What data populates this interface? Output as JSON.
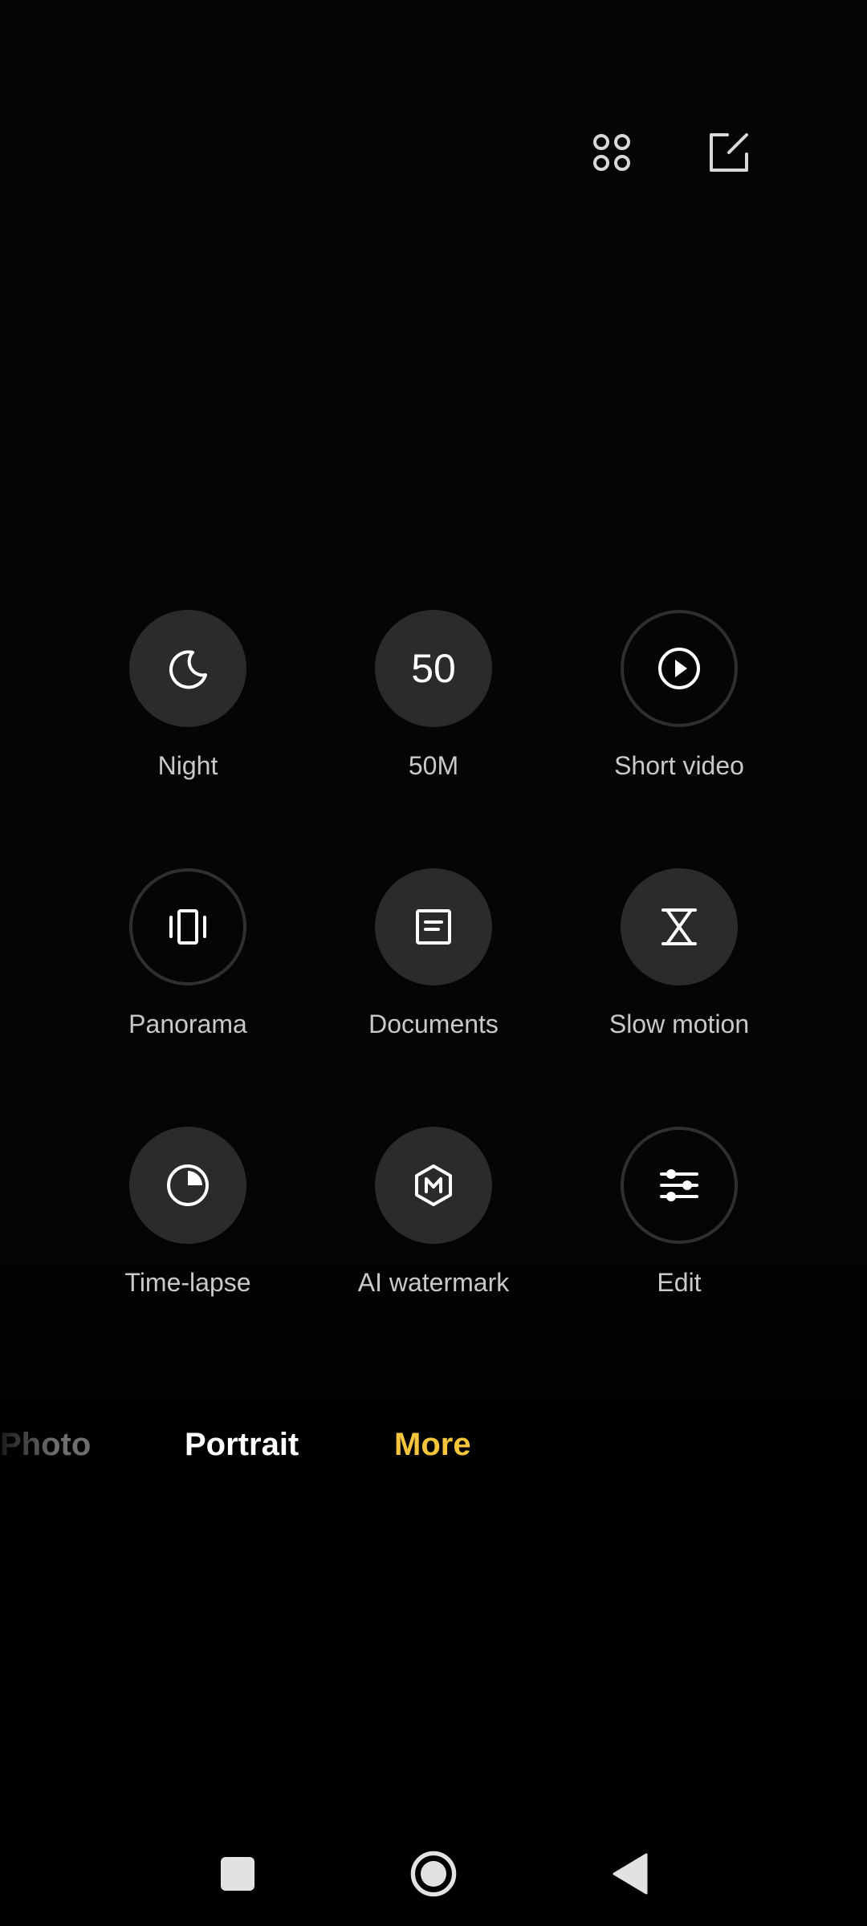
{
  "toolbar": {
    "icons": [
      "grid-four-dots-icon",
      "edit-note-icon"
    ]
  },
  "modes": [
    {
      "label": "Night",
      "icon": "moon-icon"
    },
    {
      "label": "50M",
      "icon": "50-text-icon",
      "icon_text": "50"
    },
    {
      "label": "Short video",
      "icon": "play-circle-icon"
    },
    {
      "label": "Panorama",
      "icon": "panorama-icon"
    },
    {
      "label": "Documents",
      "icon": "document-icon"
    },
    {
      "label": "Slow motion",
      "icon": "hourglass-icon"
    },
    {
      "label": "Time-lapse",
      "icon": "clock-pie-icon"
    },
    {
      "label": "AI watermark",
      "icon": "hexagon-m-icon"
    },
    {
      "label": "Edit",
      "icon": "sliders-icon"
    }
  ],
  "mode_strip": {
    "items": [
      "Photo",
      "Portrait",
      "More"
    ],
    "active": "More"
  },
  "colors": {
    "accent": "#f5c53c",
    "circle": "#2b2b2d",
    "background": "#050406"
  },
  "navbar": {
    "icons": [
      "recents-square-icon",
      "home-circle-icon",
      "back-triangle-icon"
    ]
  }
}
